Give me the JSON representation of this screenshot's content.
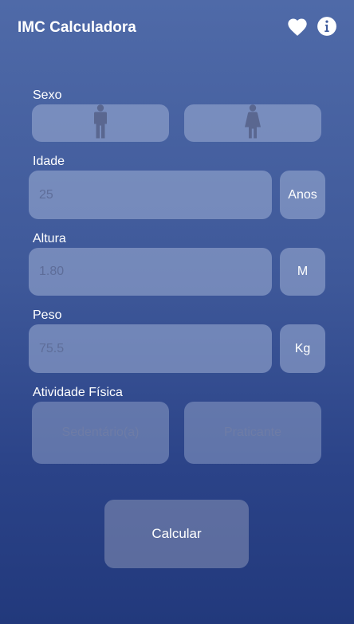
{
  "appbar": {
    "title": "IMC Calculadora",
    "icons": [
      "heart-icon",
      "info-icon"
    ]
  },
  "sexo": {
    "label": "Sexo",
    "options": [
      "male-icon",
      "female-icon"
    ]
  },
  "idade": {
    "label": "Idade",
    "value": "25",
    "unit": "Anos"
  },
  "altura": {
    "label": "Altura",
    "value": "1.80",
    "unit": "M"
  },
  "peso": {
    "label": "Peso",
    "value": "75.5",
    "unit": "Kg"
  },
  "atividade": {
    "label": "Atividade Física",
    "options": [
      "Sedentário(a)",
      "Praticante"
    ]
  },
  "actions": {
    "calculate_label": "Calcular"
  },
  "colors": {
    "background_top": "#4f6aa8",
    "background_bottom": "#22397c",
    "tile": "#a0b0d6",
    "value_text": "#5e6d99",
    "icon_fill": "#5a6790"
  }
}
